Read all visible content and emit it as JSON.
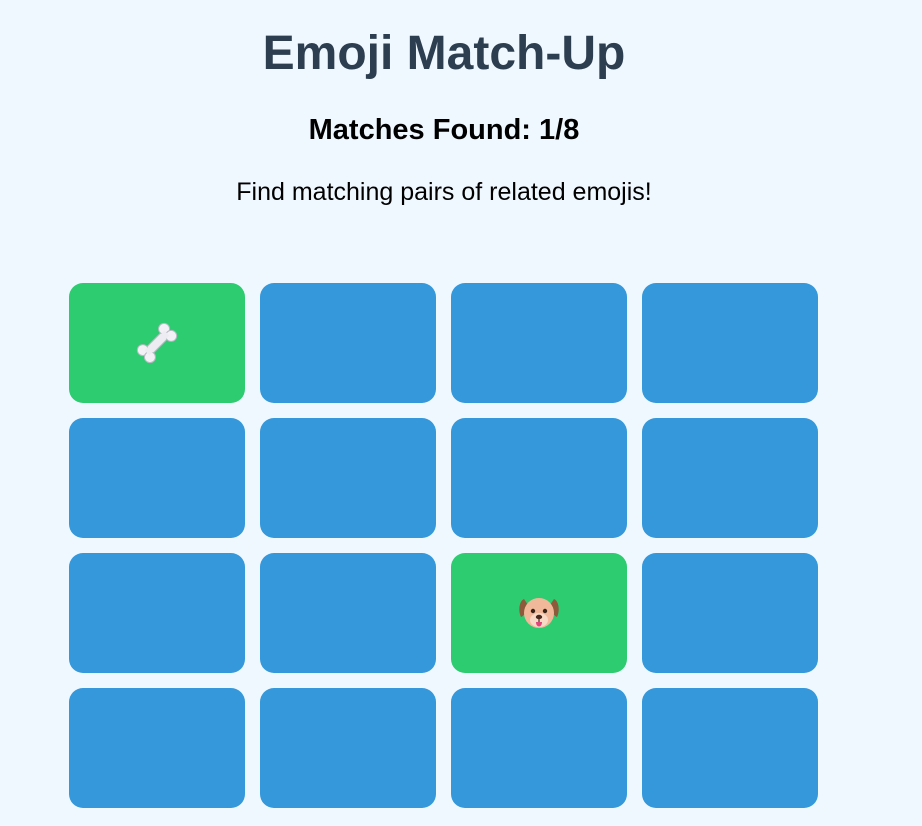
{
  "header": {
    "title": "Emoji Match-Up",
    "score": "Matches Found: 1/8",
    "instructions": "Find matching pairs of related emojis!"
  },
  "colors": {
    "background": "#f0f8ff",
    "title": "#2c3e50",
    "card_hidden": "#3498db",
    "card_matched": "#2ecc71"
  },
  "board": {
    "cards": [
      {
        "state": "matched",
        "icon": "bone-icon"
      },
      {
        "state": "hidden"
      },
      {
        "state": "hidden"
      },
      {
        "state": "hidden"
      },
      {
        "state": "hidden"
      },
      {
        "state": "hidden"
      },
      {
        "state": "hidden"
      },
      {
        "state": "hidden"
      },
      {
        "state": "hidden"
      },
      {
        "state": "hidden"
      },
      {
        "state": "matched",
        "icon": "dog-face-icon"
      },
      {
        "state": "hidden"
      },
      {
        "state": "hidden"
      },
      {
        "state": "hidden"
      },
      {
        "state": "hidden"
      },
      {
        "state": "hidden"
      }
    ]
  }
}
